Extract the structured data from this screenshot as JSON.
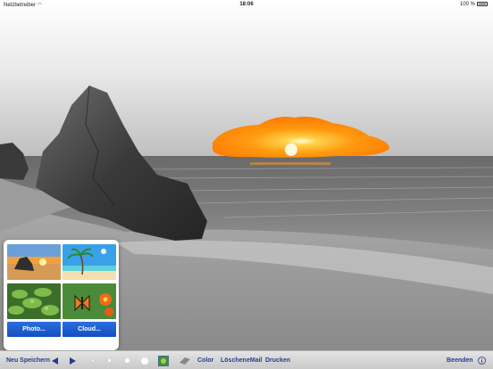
{
  "status_bar": {
    "carrier": "Netzbetreiber",
    "wifi_icon": "wifi-icon",
    "time": "18:06",
    "battery": "100 %"
  },
  "photo_picker": {
    "thumbnails": [
      {
        "name": "sunset-rock-thumbnail"
      },
      {
        "name": "palm-beach-thumbnail"
      },
      {
        "name": "green-plant-thumbnail"
      },
      {
        "name": "butterfly-thumbnail"
      }
    ],
    "photo_button": "Photo...",
    "cloud_button": "Cloud..."
  },
  "toolbar": {
    "new_save": "Neu Speichern",
    "back_icon": "triangle-left-icon",
    "forward_icon": "triangle-right-icon",
    "brush_sizes": [
      "brush-size-1",
      "brush-size-2",
      "brush-size-3",
      "brush-size-4"
    ],
    "color": "Color",
    "delete": "Löschen",
    "email": "eMail",
    "print": "Drucken",
    "quit": "Beenden",
    "info_icon": "info-icon"
  },
  "colors": {
    "toolbar_text": "#2a3a8a",
    "panel_button": "#1a5cd6",
    "sun_orange": "#ff8a00"
  }
}
